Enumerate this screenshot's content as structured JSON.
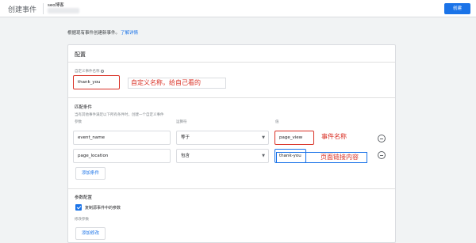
{
  "header": {
    "title": "创建事件",
    "property_name": "seo博客",
    "create_button": "创建"
  },
  "intro": {
    "text": "根据现有事件创建新事件。",
    "link": "了解详情"
  },
  "config": {
    "title": "配置",
    "event_name_label": "自定义事件名称",
    "event_name_value": "thank_you",
    "event_name_annotation": "自定义名称，给自己看的"
  },
  "matching": {
    "title": "匹配条件",
    "hint": "当有其他事件满足以下所有条件时，创建一个自定义事件",
    "col_param": "参数",
    "col_operator": "运算符",
    "col_value": "值",
    "rows": [
      {
        "param": "event_name",
        "operator": "等于",
        "value": "page_view",
        "annotation": "事件名称"
      },
      {
        "param": "page_location",
        "operator": "包含",
        "value": "thank-you",
        "annotation": "页面链接内容"
      }
    ],
    "add_condition": "添加条件"
  },
  "param_config": {
    "title": "参数配置",
    "copy_params_label": "复制源事件中的参数",
    "copy_params_checked": true,
    "modify_label": "修改参数",
    "add_modification": "添加修改"
  },
  "icons": {
    "help": "help-icon",
    "remove": "remove-circle-icon",
    "dropdown": "caret-down-icon",
    "checkbox": "check-icon"
  },
  "colors": {
    "accent": "#1a73e8",
    "annotation_red": "#d93025"
  }
}
